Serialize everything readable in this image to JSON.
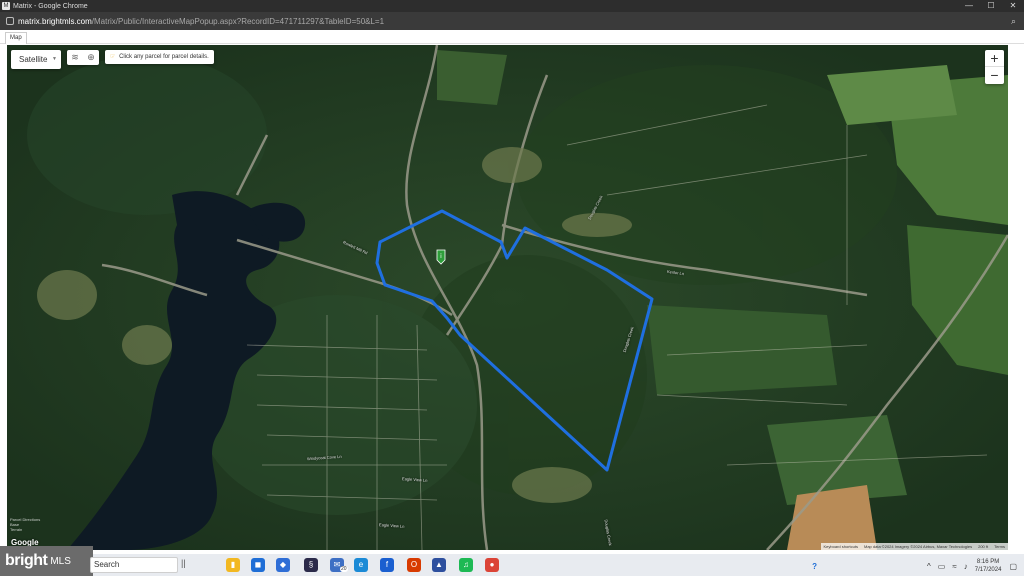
{
  "window": {
    "title": "Matrix - Google Chrome",
    "app_badge": "M",
    "controls": [
      "—",
      "☐",
      "✕"
    ]
  },
  "address": {
    "host": "matrix.brightmls.com",
    "path": "/Matrix/Public/InteractiveMapPopup.aspx?RecordID=471711297&TableID=50&L=1"
  },
  "tab": {
    "label": "Map"
  },
  "map": {
    "type_label": "Satellite",
    "hint_text": "Click any parcel for parcel details.",
    "zoom_in": "+",
    "zoom_out": "−",
    "road_labels": [
      "Douglas Creek",
      "Douglas Creek",
      "Douglas Creek",
      "Kenlor Ln",
      "Rowlett Mill Rd",
      "Eagle View Ln",
      "Windycoat Cove Ln",
      "Eagle View Ln"
    ],
    "scale_text": [
      "Parcel Directions",
      "Base",
      "Terrain"
    ],
    "logo": "Google",
    "attribution": [
      "Keyboard shortcuts",
      "Map data ©2024 Imagery ©2024 Airbus, Maxar Technologies",
      "200 ft",
      "Terms"
    ],
    "colors": {
      "boundary": "#1f6fe0",
      "pin": "#2e9e3a"
    }
  },
  "taskbar": {
    "brand_main": "bright",
    "brand_sub": "MLS",
    "search_text": "Search",
    "taskview": "||",
    "mail_badge": "20",
    "apps": [
      {
        "name": "file-explorer",
        "glyph": "▮",
        "color": "#f2b822"
      },
      {
        "name": "store",
        "glyph": "◼",
        "color": "#1f6ed6"
      },
      {
        "name": "dropbox",
        "glyph": "◆",
        "color": "#2f6ed6"
      },
      {
        "name": "dark-app",
        "glyph": "§",
        "color": "#2b2a4a"
      },
      {
        "name": "mail",
        "glyph": "✉",
        "color": "#3d6fc4"
      },
      {
        "name": "edge",
        "glyph": "e",
        "color": "#1b8ad6"
      },
      {
        "name": "facebook",
        "glyph": "f",
        "color": "#1a5fd0"
      },
      {
        "name": "office",
        "glyph": "O",
        "color": "#d83b01"
      },
      {
        "name": "photos",
        "glyph": "▲",
        "color": "#2d4f9e"
      },
      {
        "name": "spotify",
        "glyph": "♫",
        "color": "#1db954"
      },
      {
        "name": "chrome",
        "glyph": "●",
        "color": "#db4437"
      }
    ],
    "help_glyph": "?",
    "time": "8:16 PM",
    "date": "7/17/2024"
  }
}
